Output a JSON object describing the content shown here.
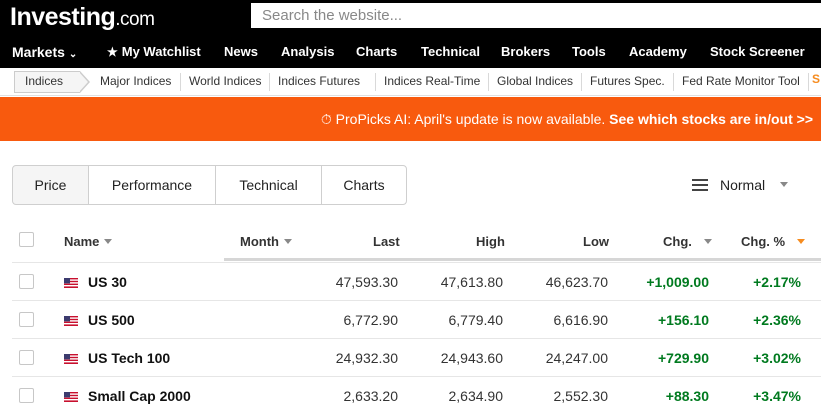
{
  "header": {
    "logo_main": "Investing",
    "logo_suffix": ".com",
    "search_placeholder": "Search the website..."
  },
  "nav": {
    "items": [
      "Markets",
      "My Watchlist",
      "News",
      "Analysis",
      "Charts",
      "Technical",
      "Brokers",
      "Tools",
      "Academy",
      "Stock Screener"
    ]
  },
  "subnav": {
    "items": [
      "Indices",
      "Major Indices",
      "World Indices",
      "Indices Futures",
      "Indices Real-Time",
      "Global Indices",
      "Futures Spec.",
      "Fed Rate Monitor Tool"
    ]
  },
  "promo": {
    "prefix": "ProPicks AI: April's update is now available.",
    "cta": "See which stocks are in/out >>"
  },
  "tabs": [
    "Price",
    "Performance",
    "Technical",
    "Charts"
  ],
  "view": {
    "label": "Normal"
  },
  "table": {
    "headers": {
      "name": "Name",
      "month": "Month",
      "last": "Last",
      "high": "High",
      "low": "Low",
      "chg": "Chg.",
      "chg_pct": "Chg. %"
    },
    "rows": [
      {
        "name": "US 30",
        "last": "47,593.30",
        "high": "47,613.80",
        "low": "46,623.70",
        "chg": "+1,009.00",
        "chg_pct": "+2.17%"
      },
      {
        "name": "US 500",
        "last": "6,772.90",
        "high": "6,779.40",
        "low": "6,616.90",
        "chg": "+156.10",
        "chg_pct": "+2.36%"
      },
      {
        "name": "US Tech 100",
        "last": "24,932.30",
        "high": "24,943.60",
        "low": "24,247.00",
        "chg": "+729.90",
        "chg_pct": "+3.02%"
      },
      {
        "name": "Small Cap 2000",
        "last": "2,633.20",
        "high": "2,634.90",
        "low": "2,552.30",
        "chg": "+88.30",
        "chg_pct": "+3.47%"
      }
    ]
  },
  "colors": {
    "promo": "#f85a0e",
    "positive": "#007a1f",
    "accent": "#f68c1f"
  }
}
